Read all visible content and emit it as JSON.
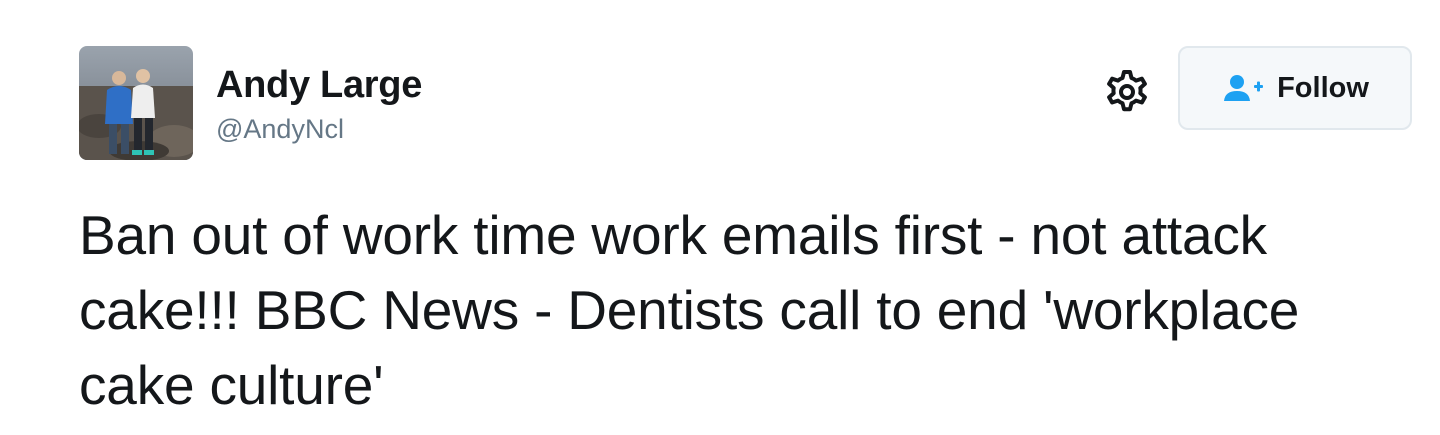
{
  "author": {
    "display_name": "Andy Large",
    "screen_name": "@AndyNcl",
    "avatar": "profile-photo"
  },
  "actions": {
    "settings_icon": "gear-icon",
    "follow_icon": "person-add-icon",
    "follow_label": "Follow"
  },
  "tweet": {
    "text": "Ban out of work time work emails first - not attack cake!!! BBC News - Dentists call to end 'workplace cake culture'"
  },
  "colors": {
    "text": "#14171a",
    "secondary_text": "#657786",
    "accent_blue": "#1da1f2",
    "button_border": "#e1e8ed",
    "button_bg": "#f5f8fa"
  }
}
